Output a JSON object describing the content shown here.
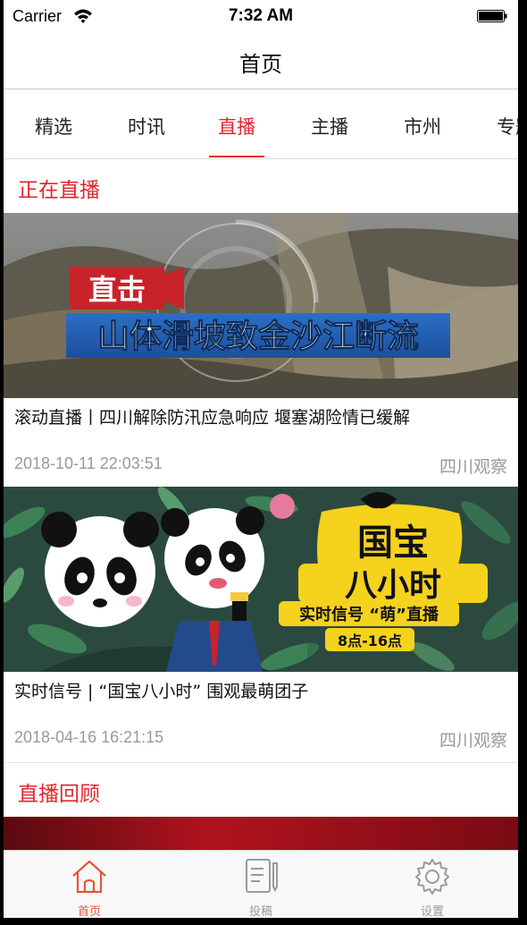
{
  "status_bar": {
    "carrier": "Carrier",
    "time": "7:32 AM"
  },
  "nav": {
    "title": "首页"
  },
  "tabs": [
    {
      "label": "精选"
    },
    {
      "label": "时讯"
    },
    {
      "label": "直播",
      "active": true
    },
    {
      "label": "主播"
    },
    {
      "label": "市州"
    },
    {
      "label": "专题"
    }
  ],
  "live_section": {
    "title": "正在直播"
  },
  "live_items": [
    {
      "image_text": {
        "badge": "直击",
        "headline": "山体滑坡致金沙江断流"
      },
      "title": "滚动直播丨四川解除防汛应急响应 堰塞湖险情已缓解",
      "time": "2018-10-11 22:03:51",
      "source": "四川观察"
    },
    {
      "image_text": {
        "line1": "国宝",
        "line2": "八小时",
        "line3": "实时信号 “萌”直播",
        "line4": "8点-16点"
      },
      "title": "实时信号 | “国宝八小时” 围观最萌团子",
      "time": "2018-04-16 16:21:15",
      "source": "四川观察"
    }
  ],
  "replay_section": {
    "title": "直播回顾"
  },
  "tabbar": [
    {
      "label": "首页",
      "icon": "home-icon",
      "active": true
    },
    {
      "label": "投稿",
      "icon": "compose-icon"
    },
    {
      "label": "设置",
      "icon": "gear-icon"
    }
  ],
  "colors": {
    "accent": "#e3262e",
    "tabbar_active": "#e8543a",
    "meta_text": "#999999"
  }
}
